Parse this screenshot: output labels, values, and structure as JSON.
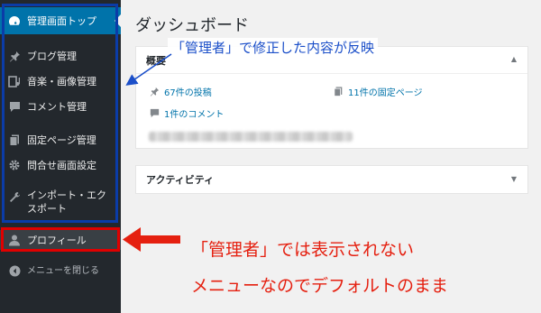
{
  "sidebar": {
    "items": [
      {
        "label": "管理画面トップ",
        "icon": "dashboard-icon"
      },
      {
        "label": "ブログ管理",
        "icon": "pin-icon"
      },
      {
        "label": "音楽・画像管理",
        "icon": "media-icon"
      },
      {
        "label": "コメント管理",
        "icon": "comment-icon"
      },
      {
        "label": "固定ページ管理",
        "icon": "page-icon"
      },
      {
        "label": "問合せ画面設定",
        "icon": "gear-icon"
      },
      {
        "label": "インポート・エクスポート",
        "icon": "wrench-icon"
      },
      {
        "label": "プロフィール",
        "icon": "user-icon"
      }
    ],
    "collapse_label": "メニューを閉じる"
  },
  "main": {
    "title": "ダッシュボード",
    "glance_box": {
      "heading": "概要",
      "posts": "67件の投稿",
      "pages": "11件の固定ページ",
      "comments": "1件のコメント"
    },
    "activity_box": {
      "heading": "アクティビティ"
    }
  },
  "annotations": {
    "blue_note": "「管理者」で修正した内容が反映",
    "red_note_line1": "「管理者」では表示されない",
    "red_note_line2": "メニューなのでデフォルトのまま"
  },
  "colors": {
    "sidebar_bg": "#23282d",
    "accent": "#0073aa",
    "annotation_blue": "#1b4fc9",
    "annotation_red": "#e52010"
  }
}
